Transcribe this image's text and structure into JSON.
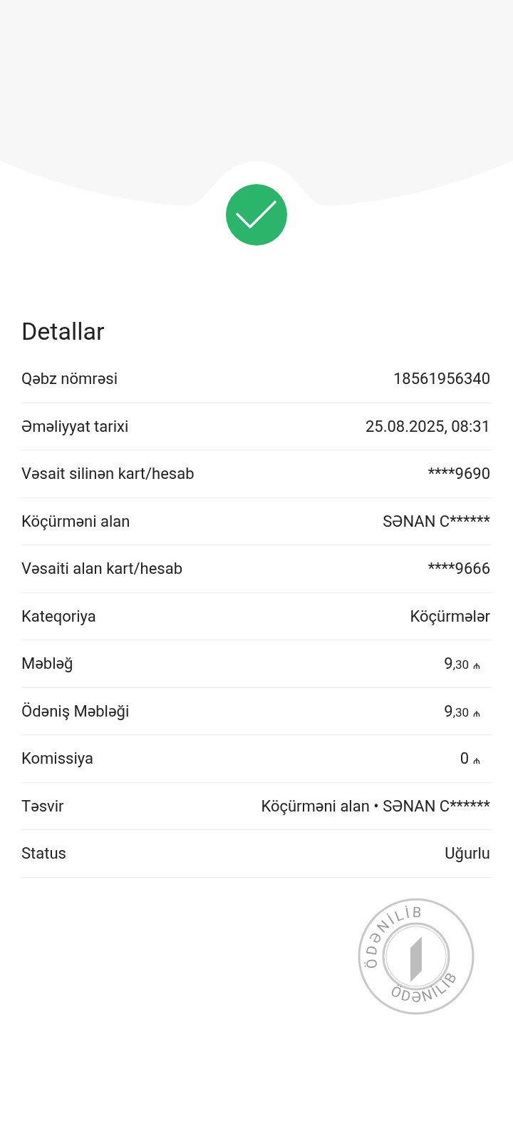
{
  "title": "Detallar",
  "rows": [
    {
      "label": "Qəbz nömrəsi",
      "value": "18561956340"
    },
    {
      "label": "Əməliyyat tarixi",
      "value": "25.08.2025, 08:31"
    },
    {
      "label": "Vəsait silinən kart/hesab",
      "value": "****9690"
    },
    {
      "label": "Köçürməni alan",
      "value": "SƏNAN C******"
    },
    {
      "label": "Vəsaiti alan kart/hesab",
      "value": "****9666"
    },
    {
      "label": "Kateqoriya",
      "value": "Köçürmələr"
    },
    {
      "label": "Məbləğ",
      "value": "9",
      "fraction": ",30",
      "currency": "₼"
    },
    {
      "label": "Ödəniş Məbləği",
      "value": "9",
      "fraction": ",30",
      "currency": "₼"
    },
    {
      "label": "Komissiya",
      "value": "0",
      "currency": "₼"
    },
    {
      "label": "Təsvir",
      "value": "Köçürməni alan • SƏNAN C******"
    },
    {
      "label": "Status",
      "value": "Uğurlu"
    }
  ],
  "stamp": {
    "top_text": "ÖDƏNİLİB",
    "bottom_text": "ÖDƏNİLİB"
  }
}
